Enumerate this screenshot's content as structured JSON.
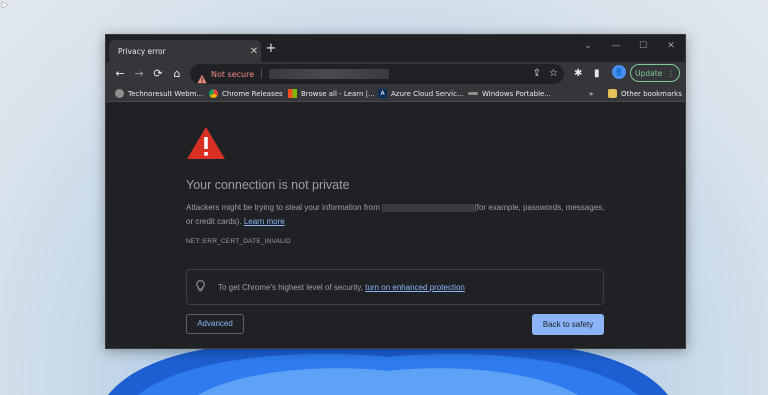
{
  "window": {
    "tab_title": "Privacy error",
    "tab_close": "✕",
    "new_tab": "+",
    "controls": {
      "minimize": "—",
      "maximize": "☐",
      "close": "✕"
    }
  },
  "toolbar": {
    "back": "←",
    "forward": "→",
    "reload": "⟳",
    "home": "⌂",
    "security_status": "Not secure",
    "update_label": "Update",
    "menu": "⋮",
    "share": "⇪",
    "star": "☆",
    "extensions": "✱",
    "sidepanel": "▮",
    "profile_initial": "👤"
  },
  "bookmarks": {
    "items": [
      {
        "label": "Technoresult Webm...",
        "icon": "globe-icon",
        "color": "#8e8e8e"
      },
      {
        "label": "Chrome Releases",
        "icon": "chrome-icon",
        "color": "#e8b33a"
      },
      {
        "label": "Browse all - Learn |...",
        "icon": "microsoft-icon",
        "color": "#f25022"
      },
      {
        "label": "Azure Cloud Servic...",
        "icon": "azure-icon",
        "color": "#0a2e5c"
      },
      {
        "label": "Windows Portable...",
        "icon": "link-icon",
        "color": "#8e8e8e"
      }
    ],
    "overflow": "»",
    "other": "Other bookmarks"
  },
  "page": {
    "heading": "Your connection is not private",
    "para_before_host": "Attackers might be trying to steal your information from",
    "para_after_host": "(for example, passwords, messages, or credit cards).",
    "learn_more": "Learn more",
    "error_code": "NET::ERR_CERT_DATE_INVALID",
    "enhanced_prefix": "To get Chrome's highest level of security,",
    "enhanced_link": "turn on enhanced protection",
    "advanced_button": "Advanced",
    "back_button": "Back to safety"
  },
  "colors": {
    "warning_red": "#d93025",
    "link_blue": "#8ab4f8",
    "update_green": "#81c995"
  }
}
